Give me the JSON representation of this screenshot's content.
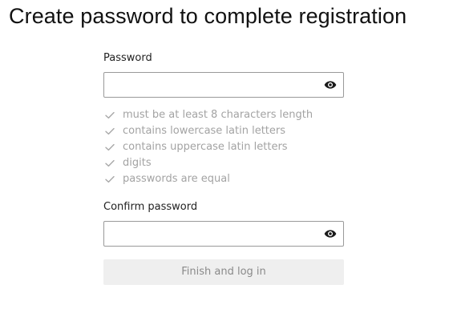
{
  "page": {
    "title": "Create password to complete registration"
  },
  "password": {
    "label": "Password",
    "value": "",
    "visibility_icon": "eye-icon"
  },
  "rules": [
    {
      "text": "must be at least 8 characters length",
      "icon": "check-icon",
      "satisfied": false
    },
    {
      "text": "contains lowercase latin letters",
      "icon": "check-icon",
      "satisfied": false
    },
    {
      "text": "contains uppercase latin letters",
      "icon": "check-icon",
      "satisfied": false
    },
    {
      "text": "digits",
      "icon": "check-icon",
      "satisfied": false
    },
    {
      "text": "passwords are equal",
      "icon": "check-icon",
      "satisfied": false
    }
  ],
  "confirm": {
    "label": "Confirm password",
    "value": "",
    "visibility_icon": "eye-icon"
  },
  "submit": {
    "label": "Finish and log in",
    "disabled": true
  },
  "colors": {
    "rule_text": "#a3a3a3",
    "button_bg": "#efefef",
    "button_text": "#8a8a8a",
    "input_border": "#9a9a9a"
  }
}
